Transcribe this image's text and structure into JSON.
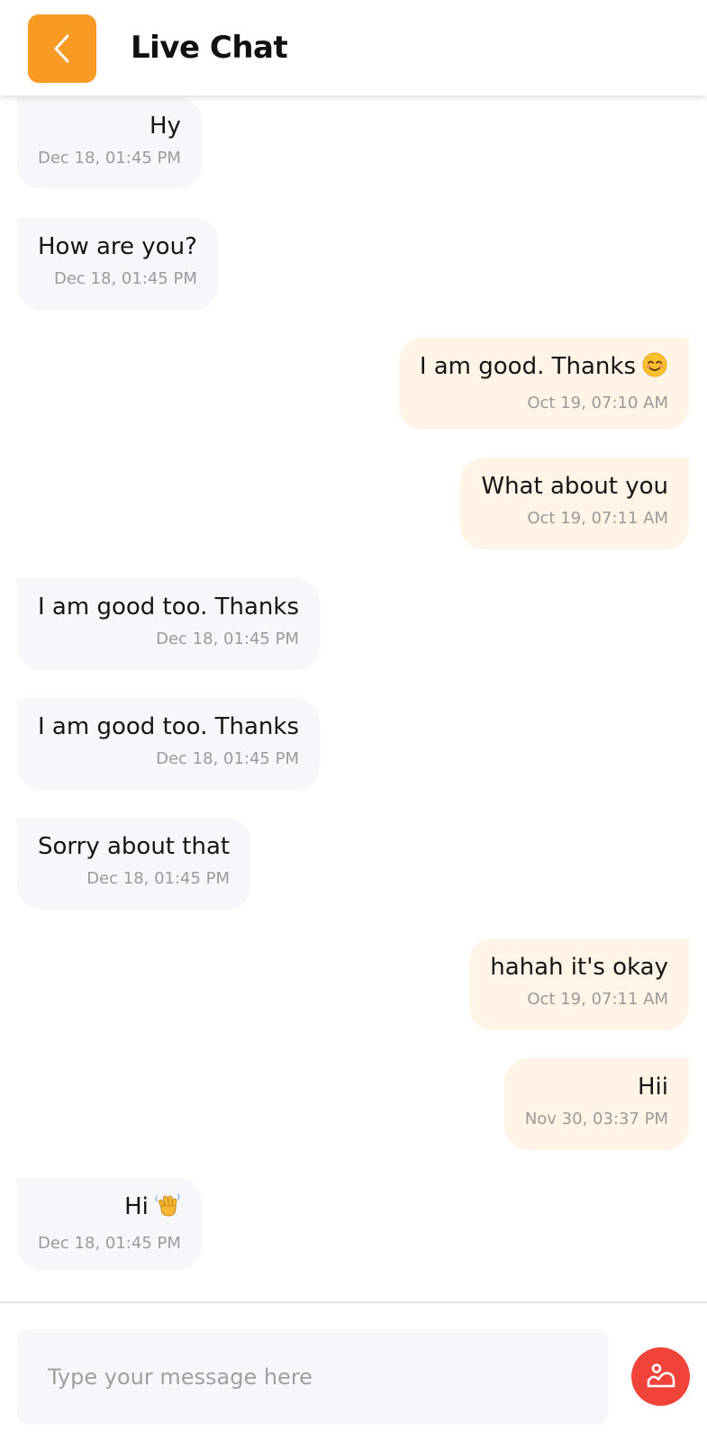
{
  "header": {
    "title": "Live Chat",
    "accent_color": "#f99a25",
    "back_icon": "chevron-left-icon"
  },
  "messages": [
    {
      "direction": "received",
      "text": "Hy",
      "time": "Dec 18, 01:45 PM"
    },
    {
      "direction": "received",
      "text": "How are you?",
      "time": "Dec 18, 01:45 PM"
    },
    {
      "direction": "sent",
      "text": "I am good. Thanks",
      "emoji": "smiling-face-emoji",
      "time": "Oct 19, 07:10 AM"
    },
    {
      "direction": "sent",
      "text": "What about you",
      "time": "Oct 19, 07:11 AM"
    },
    {
      "direction": "received",
      "text": "I am good too. Thanks",
      "time": "Dec 18, 01:45 PM"
    },
    {
      "direction": "received",
      "text": "I am good too. Thanks",
      "time": "Dec 18, 01:45 PM"
    },
    {
      "direction": "received",
      "text": "Sorry about that",
      "time": "Dec 18, 01:45 PM"
    },
    {
      "direction": "sent",
      "text": "hahah it's okay",
      "time": "Oct 19, 07:11 AM"
    },
    {
      "direction": "sent",
      "text": "Hii",
      "time": "Nov 30, 03:37 PM"
    },
    {
      "direction": "received",
      "text": "Hi",
      "emoji": "waving-hand-emoji",
      "time": "Dec 18, 01:45 PM"
    }
  ],
  "composer": {
    "placeholder": "Type your message here",
    "attach_icon": "image-icon",
    "attach_color": "#f0443b"
  },
  "colors": {
    "received_bubble": "#f6f7fb",
    "sent_bubble": "#fff4e6",
    "timestamp": "#9a9a9a"
  }
}
